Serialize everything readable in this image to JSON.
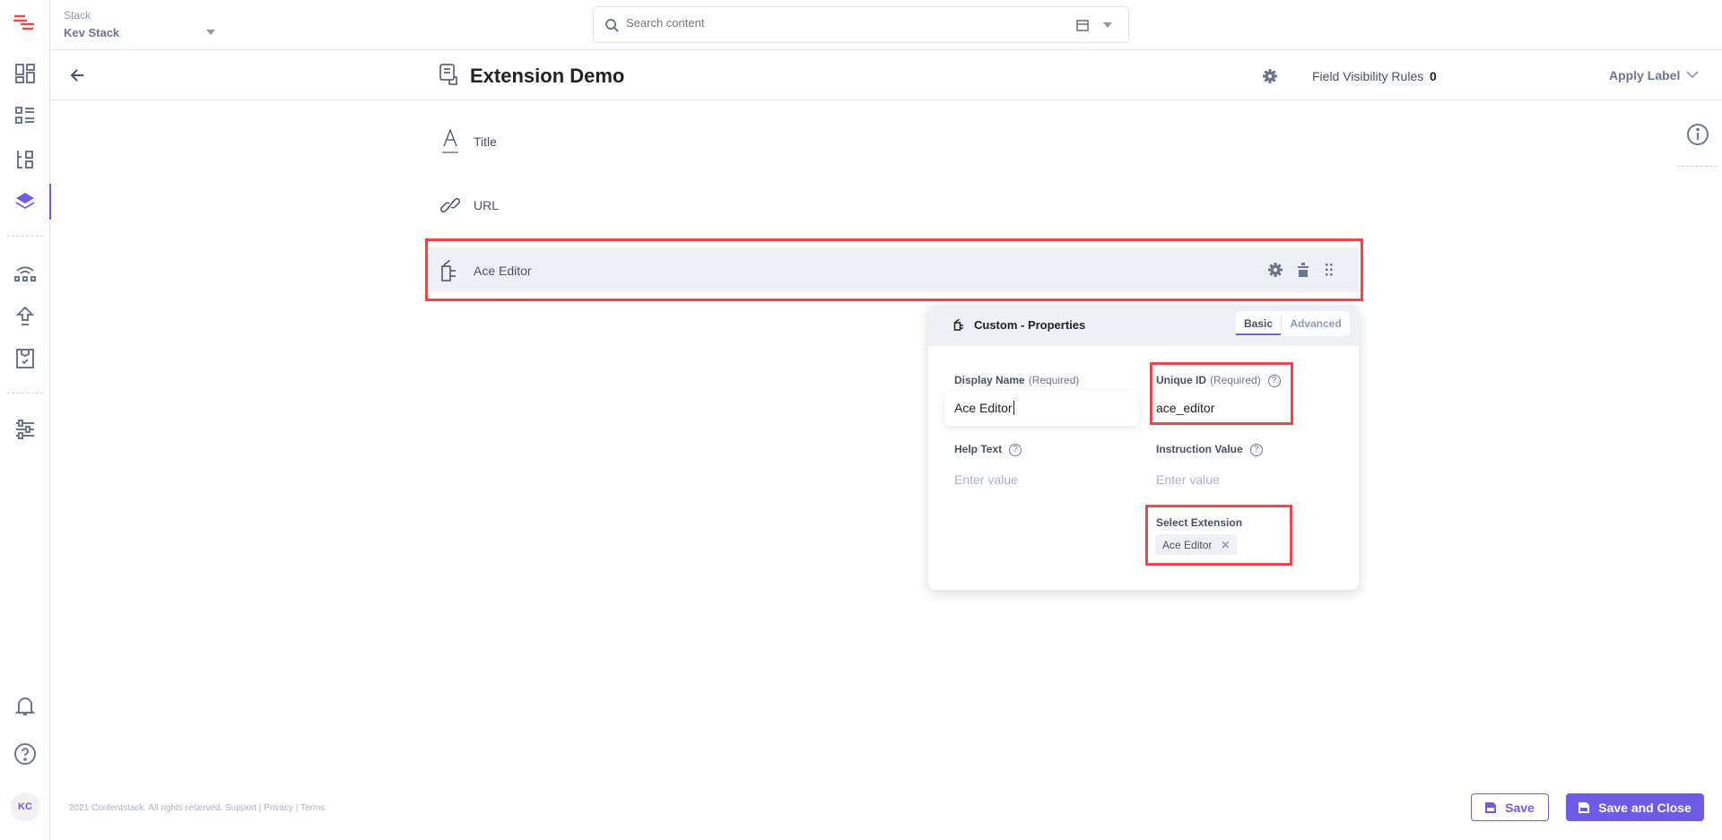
{
  "topbar": {
    "stack_label": "Stack",
    "stack_name": "Kev Stack",
    "search_placeholder": "Search content"
  },
  "header": {
    "title": "Extension Demo",
    "visibility_label": "Field Visibility Rules",
    "visibility_count": "0",
    "apply_label": "Apply Label"
  },
  "fields": [
    {
      "label": "Title",
      "icon": "text-icon"
    },
    {
      "label": "URL",
      "icon": "link-icon"
    },
    {
      "label": "Ace Editor",
      "icon": "extension-plug-icon"
    }
  ],
  "properties": {
    "title": "Custom - Properties",
    "tabs": [
      "Basic",
      "Advanced"
    ],
    "active_tab": "Basic",
    "display_name_label": "Display Name",
    "required": "(Required)",
    "display_name_value": "Ace Editor",
    "unique_id_label": "Unique ID",
    "unique_id_value": "ace_editor",
    "help_text_label": "Help Text",
    "help_text_placeholder": "Enter value",
    "instruction_label": "Instruction Value",
    "instruction_placeholder": "Enter value",
    "select_extension_label": "Select Extension",
    "selected_extension": "Ace Editor"
  },
  "footer": {
    "copyright": "2021 Contentstack. All rights reserved.",
    "support": "Support",
    "privacy": "Privacy",
    "terms": "Terms",
    "save": "Save",
    "save_close": "Save and Close"
  },
  "user": {
    "initials": "KC"
  },
  "colors": {
    "accent": "#6c5ce7",
    "highlight": "#f0454b",
    "row_bg": "#edf1f5"
  }
}
